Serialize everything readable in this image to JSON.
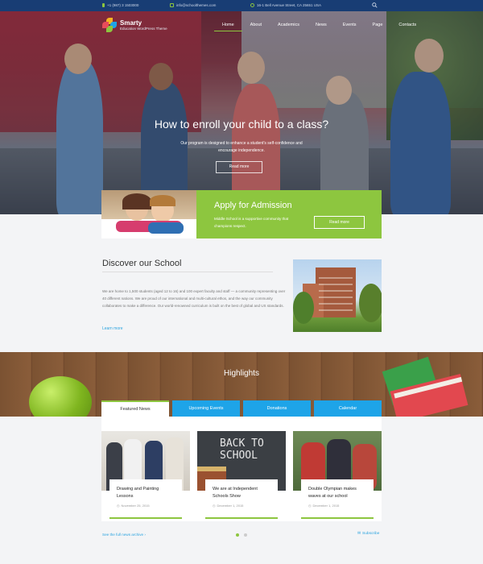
{
  "topbar": {
    "phone": "+1 (987) 3 1503000",
    "email": "info@schoolthemes.com",
    "address": "16-1 Bell Avenue Street, CA 25651 USA"
  },
  "brand": {
    "name": "Smarty",
    "tagline": "Education WordPress Theme"
  },
  "nav": [
    "Home",
    "About",
    "Academics",
    "News",
    "Events",
    "Page",
    "Contacts"
  ],
  "hero": {
    "title": "How to enroll your child to a class?",
    "text": "Our program is designed to enhance a student's self-confidence and encourage independence.",
    "button": "Read more"
  },
  "admission": {
    "title": "Apply for Admission",
    "text": "Middle School is a supportive community that champions respect.",
    "button": "Read more"
  },
  "discover": {
    "title": "Discover our School",
    "text": "We are home to 1,500 students (aged 12 to 16) and 100 expert faculty and staff — a community representing over 40 different nations. We are proud of our international and multi-cultural ethos, and the way our community collaborates to make a difference. Our world-renowned curriculum is built on the best of global and US standards.",
    "link": "Learn more"
  },
  "highlights": {
    "title": "Highlights",
    "tabs": [
      "Featured News",
      "Upcoming Events",
      "Donations",
      "Calendar"
    ],
    "news": [
      {
        "title": "Drawing and Painting Lessons",
        "date": "November 25, 2015"
      },
      {
        "title": "We are at Independent Schools Show",
        "date": "December 1, 2015"
      },
      {
        "title": "Double Olympian makes waves at our school",
        "date": "December 1, 2015"
      }
    ],
    "photo_text": "BACK TO SCHOOL"
  },
  "footer": {
    "archive": "See the full news archive ›",
    "subscribe": "Subscribe"
  },
  "colors": {
    "navy": "#183d74",
    "green": "#8dc63f",
    "blue": "#1ea4e8"
  }
}
